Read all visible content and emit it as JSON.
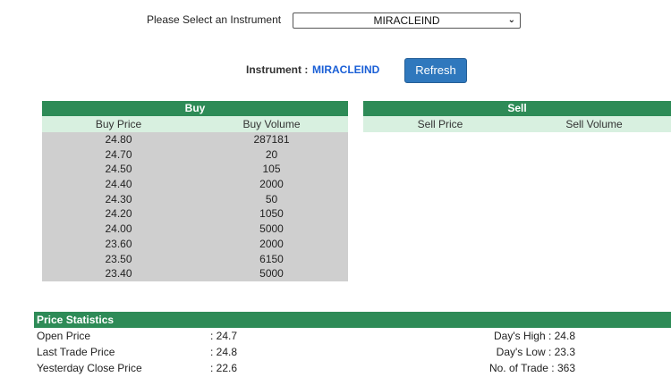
{
  "selector": {
    "label": "Please Select an Instrument",
    "value": "MIRACLEIND"
  },
  "instrument": {
    "label": "Instrument :",
    "value": "MIRACLEIND",
    "refresh_label": "Refresh"
  },
  "buy": {
    "title": "Buy",
    "headers": [
      "Buy Price",
      "Buy Volume"
    ],
    "rows": [
      [
        "24.80",
        "287181"
      ],
      [
        "24.70",
        "20"
      ],
      [
        "24.50",
        "105"
      ],
      [
        "24.40",
        "2000"
      ],
      [
        "24.30",
        "50"
      ],
      [
        "24.20",
        "1050"
      ],
      [
        "24.00",
        "5000"
      ],
      [
        "23.60",
        "2000"
      ],
      [
        "23.50",
        "6150"
      ],
      [
        "23.40",
        "5000"
      ]
    ]
  },
  "sell": {
    "title": "Sell",
    "headers": [
      "Sell Price",
      "Sell Volume"
    ],
    "rows": []
  },
  "stats": {
    "title": "Price Statistics",
    "left": [
      {
        "label": "Open Price",
        "value": ": 24.7"
      },
      {
        "label": "Last Trade Price",
        "value": ": 24.8"
      },
      {
        "label": "Yesterday Close Price",
        "value": ": 22.6"
      }
    ],
    "right": [
      "Day's High : 24.8",
      "Day's Low : 23.3",
      "No. of Trade : 363"
    ]
  },
  "colors": {
    "header_green": "#2e8b57",
    "subheader_green": "#d8f0e0",
    "rows_gray": "#cfcfcf",
    "button_blue": "#2f78bd",
    "instrument_blue": "#1a5fd6"
  }
}
